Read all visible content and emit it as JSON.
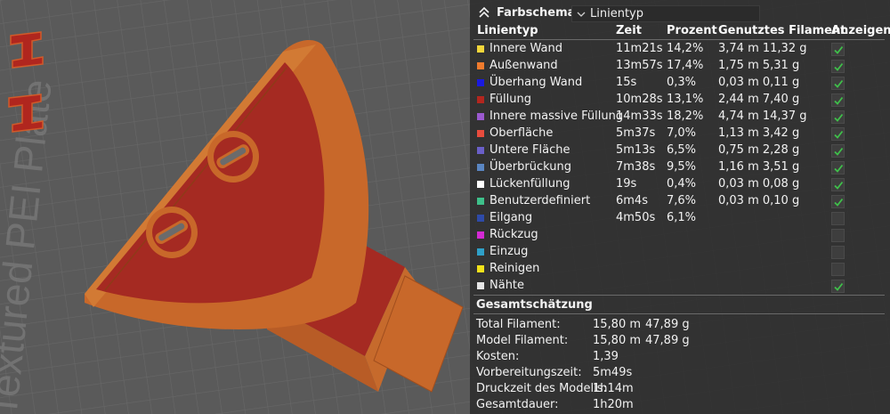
{
  "header": {
    "title": "Farbschema",
    "view_selected": "Linientyp"
  },
  "table": {
    "columns": {
      "type": "Linientyp",
      "time": "Zeit",
      "percent": "Prozent",
      "filament": "Genutztes Filament",
      "show": "Anzeigen"
    },
    "rows": [
      {
        "label": "Innere Wand",
        "color": "#f2d63a",
        "time": "11m21s",
        "percent": "14,2%",
        "filament": "3,74 m  11,32 g",
        "shown": true
      },
      {
        "label": "Außenwand",
        "color": "#f07b2d",
        "time": "13m57s",
        "percent": "17,4%",
        "filament": "1,75 m  5,31 g",
        "shown": true
      },
      {
        "label": "Überhang Wand",
        "color": "#1a1ae0",
        "time": "15s",
        "percent": "0,3%",
        "filament": "0,03 m  0,11 g",
        "shown": true
      },
      {
        "label": "Füllung",
        "color": "#b3261e",
        "time": "10m28s",
        "percent": "13,1%",
        "filament": "2,44 m  7,40 g",
        "shown": true
      },
      {
        "label": "Innere massive Füllung",
        "color": "#9b59d0",
        "time": "14m33s",
        "percent": "18,2%",
        "filament": "4,74 m  14,37 g",
        "shown": true
      },
      {
        "label": "Oberfläche",
        "color": "#e84c3d",
        "time": "5m37s",
        "percent": "7,0%",
        "filament": "1,13 m  3,42 g",
        "shown": true
      },
      {
        "label": "Untere Fläche",
        "color": "#6a5fc8",
        "time": "5m13s",
        "percent": "6,5%",
        "filament": "0,75 m  2,28 g",
        "shown": true
      },
      {
        "label": "Überbrückung",
        "color": "#5a86c2",
        "time": "7m38s",
        "percent": "9,5%",
        "filament": "1,16 m  3,51 g",
        "shown": true
      },
      {
        "label": "Lückenfüllung",
        "color": "#ffffff",
        "time": "19s",
        "percent": "0,4%",
        "filament": "0,03 m  0,08 g",
        "shown": true
      },
      {
        "label": "Benutzerdefiniert",
        "color": "#3ec08a",
        "time": "6m4s",
        "percent": "7,6%",
        "filament": "0,03 m  0,10 g",
        "shown": true
      },
      {
        "label": "Eilgang",
        "color": "#2e4aa8",
        "time": "4m50s",
        "percent": "6,1%",
        "filament": "",
        "shown": false
      },
      {
        "label": "Rückzug",
        "color": "#d42ad4",
        "time": "",
        "percent": "",
        "filament": "",
        "shown": false
      },
      {
        "label": "Einzug",
        "color": "#2fa0c8",
        "time": "",
        "percent": "",
        "filament": "",
        "shown": false
      },
      {
        "label": "Reinigen",
        "color": "#f2e21a",
        "time": "",
        "percent": "",
        "filament": "",
        "shown": false
      },
      {
        "label": "Nähte",
        "color": "#e6e6e6",
        "time": "",
        "percent": "",
        "filament": "",
        "shown": true
      }
    ]
  },
  "estimate": {
    "title": "Gesamtschätzung",
    "rows": [
      {
        "label": "Total Filament:",
        "value": "15,80 m",
        "value2": "47,89 g"
      },
      {
        "label": "Model Filament:",
        "value": "15,80 m",
        "value2": "47,89 g"
      },
      {
        "label": "Kosten:",
        "value": "1,39",
        "value2": ""
      },
      {
        "label": "Vorbereitungszeit:",
        "value": "5m49s",
        "value2": ""
      },
      {
        "label": "Druckzeit des Modells:",
        "value": "1h14m",
        "value2": ""
      },
      {
        "label": "Gesamtdauer:",
        "value": "1h20m",
        "value2": ""
      }
    ]
  },
  "colors": {
    "check": "#3fbf4a",
    "model_fill": "#a52a22",
    "model_wall": "#c8682a"
  },
  "viewport": {
    "plate_text": "Textured PEI Plate"
  }
}
